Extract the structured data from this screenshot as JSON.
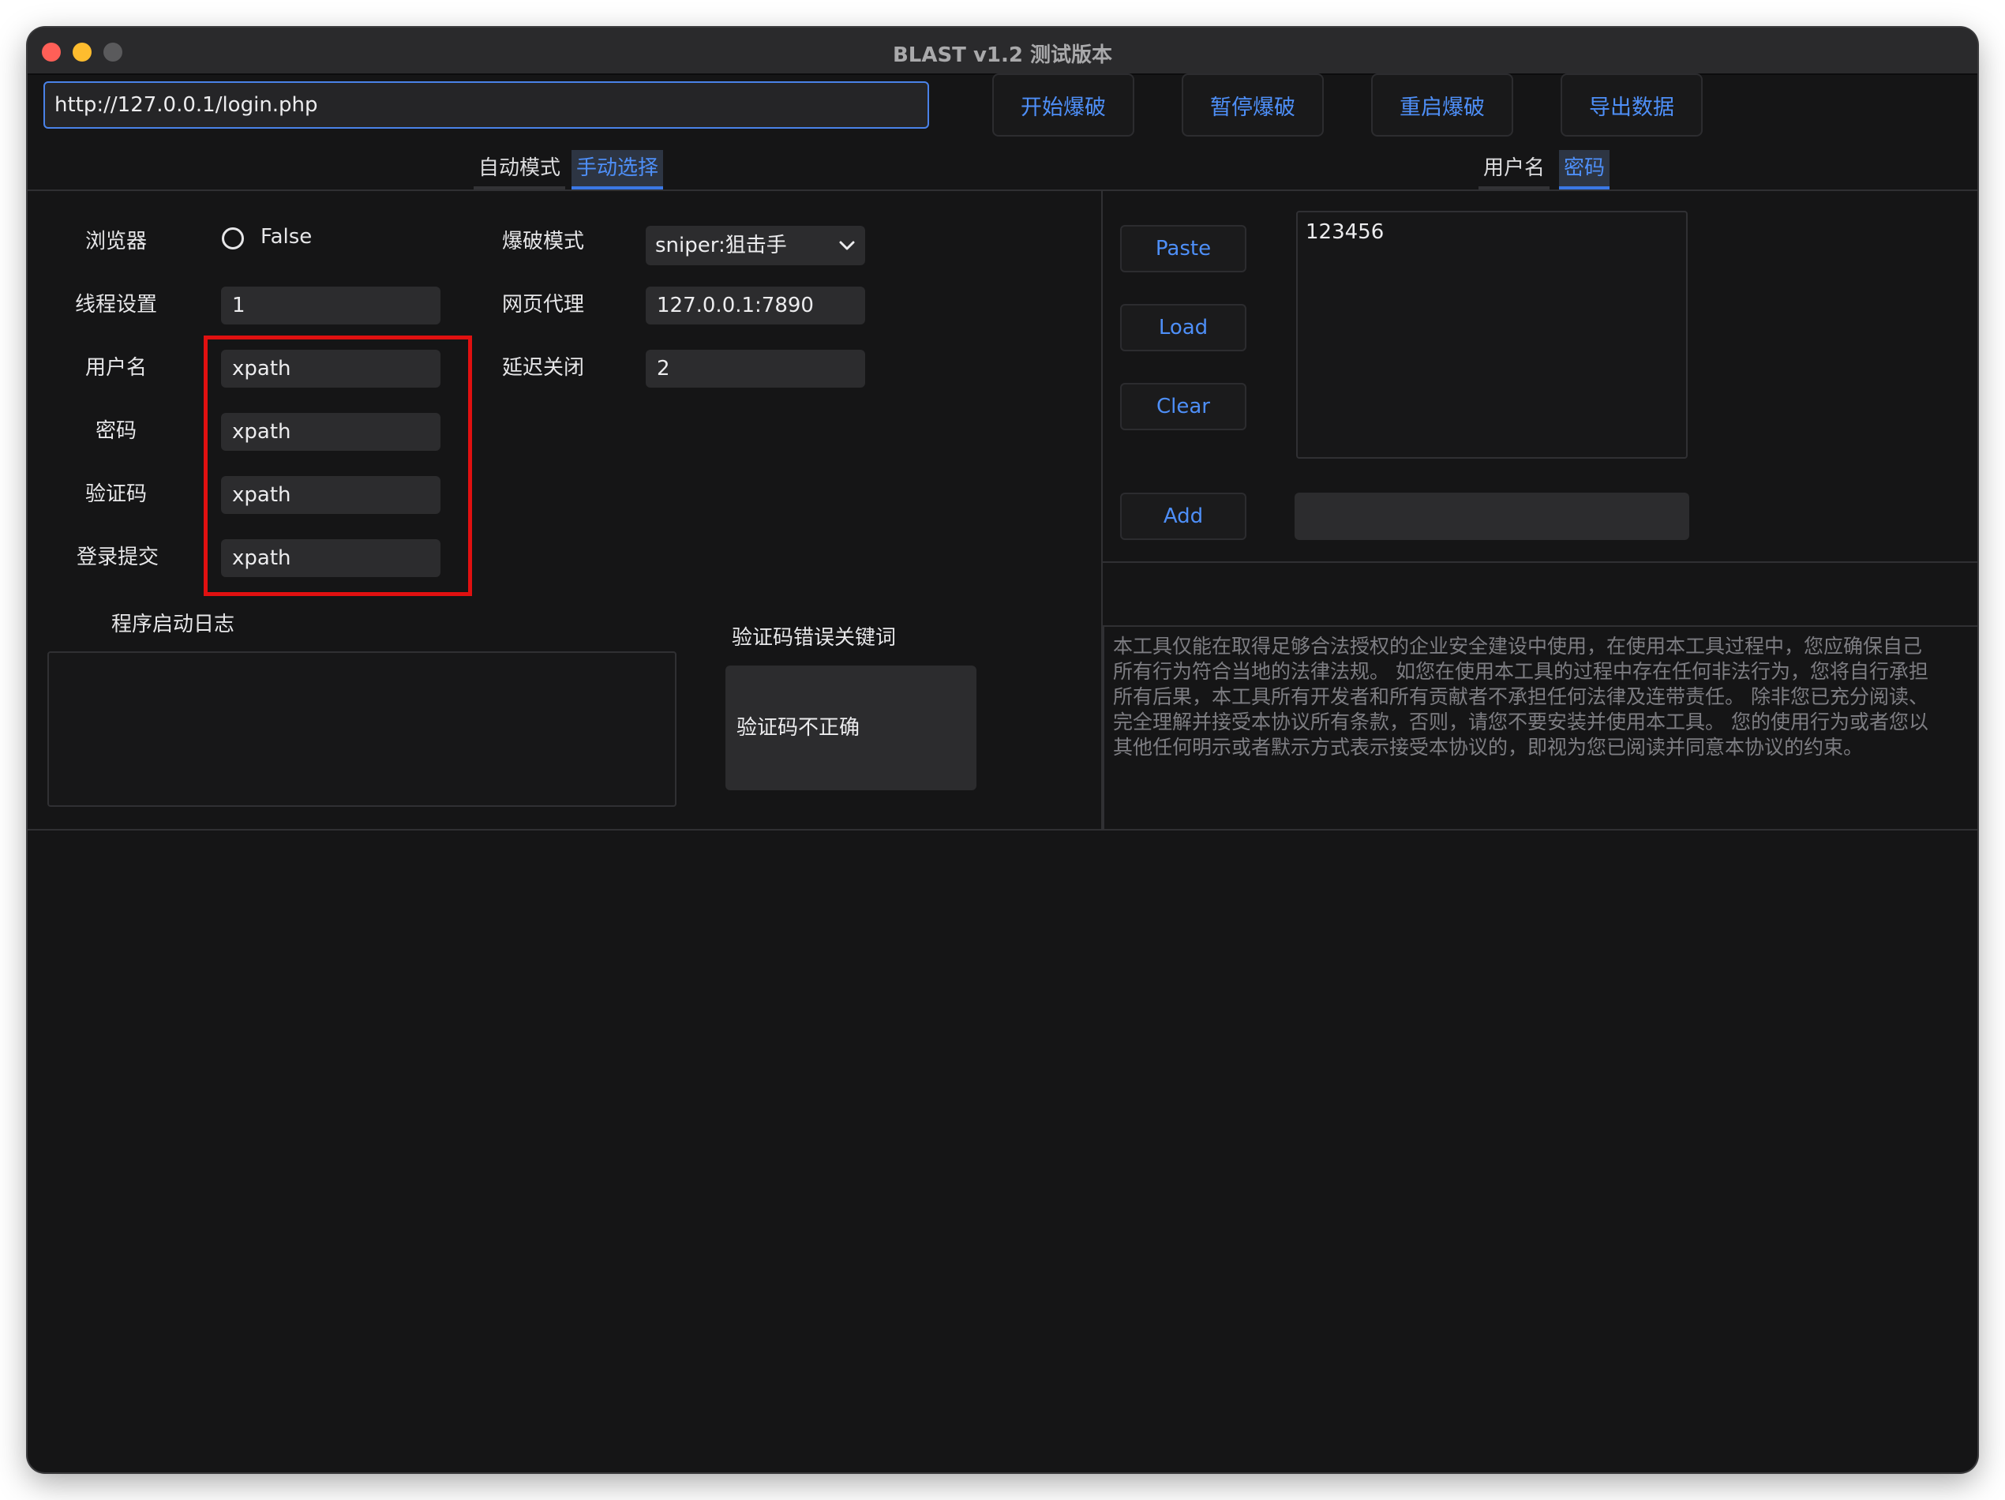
{
  "window": {
    "title": "BLAST v1.2 测试版本"
  },
  "toolbar": {
    "url": "http://127.0.0.1/login.php",
    "buttons": [
      "开始爆破",
      "暂停爆破",
      "重启爆破",
      "导出数据"
    ]
  },
  "left_tabs": {
    "auto": "自动模式",
    "manual": "手动选择",
    "active": "手动选择"
  },
  "right_tabs": {
    "username": "用户名",
    "password": "密码",
    "active": "密码"
  },
  "settings": {
    "browser_label": "浏览器",
    "browser_value": "False",
    "threads_label": "线程设置",
    "threads_value": "1",
    "username_label": "用户名",
    "username_value": "xpath",
    "password_label": "密码",
    "password_value": "xpath",
    "captcha_label": "验证码",
    "captcha_value": "xpath",
    "submit_label": "登录提交",
    "submit_value": "xpath",
    "mode_label": "爆破模式",
    "mode_value": "sniper:狙击手",
    "proxy_label": "网页代理",
    "proxy_value": "127.0.0.1:7890",
    "delay_label": "延迟关闭",
    "delay_value": "2"
  },
  "log": {
    "label": "程序启动日志"
  },
  "captcha_error": {
    "label": "验证码错误关键词",
    "value": "验证码不正确"
  },
  "wordlist": {
    "paste": "Paste",
    "load": "Load",
    "clear": "Clear",
    "add": "Add",
    "entries": [
      "123456"
    ],
    "add_value": ""
  },
  "disclaimer": [
    "本工具仅能在取得足够合法授权的企业安全建设中使用，在使用本工具过程中，您应确保自己",
    "所有行为符合当地的法律法规。 如您在使用本工具的过程中存在任何非法行为，您将自行承担",
    "所有后果，本工具所有开发者和所有贡献者不承担任何法律及连带责任。 除非您已充分阅读、",
    "完全理解并接受本协议所有条款，否则，请您不要安装并使用本工具。 您的使用行为或者您以",
    "其他任何明示或者默示方式表示接受本协议的，即视为您已阅读并同意本协议的约束。"
  ],
  "colors": {
    "accent": "#4e8ff8",
    "highlight": "#e01010",
    "background": "#151516"
  }
}
